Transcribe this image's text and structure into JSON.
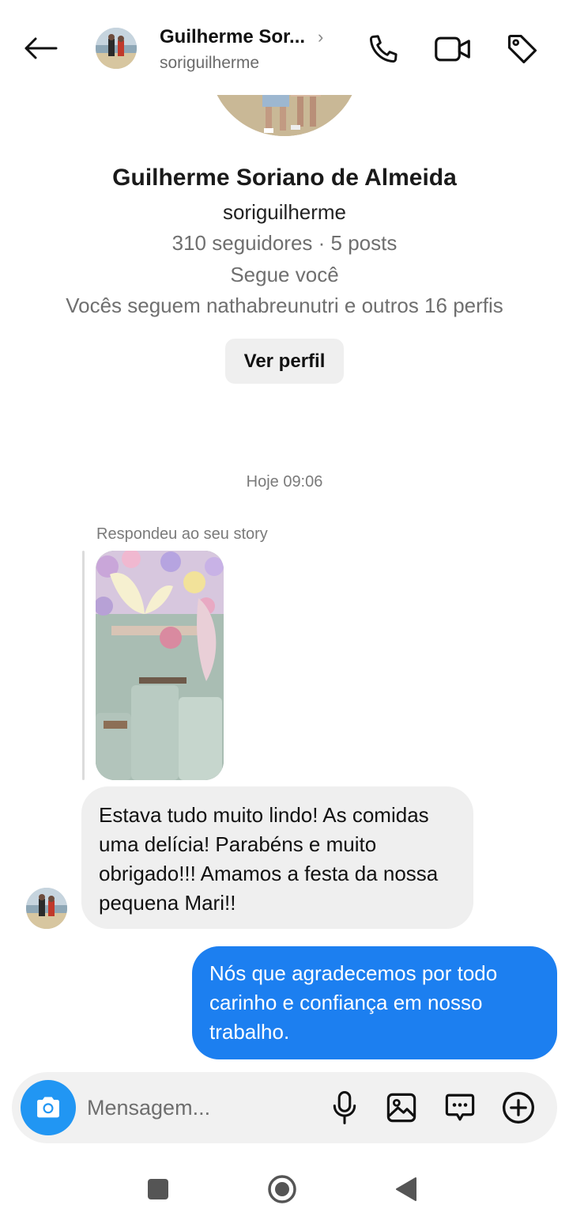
{
  "header": {
    "name": "Guilherme Sor...",
    "username": "soriguilherme"
  },
  "profile": {
    "full_name": "Guilherme Soriano de Almeida",
    "username": "soriguilherme",
    "stats": "310 seguidores · 5 posts",
    "follows_you": "Segue você",
    "mutual": "Vocês seguem nathabreunutri e outros 16 perfis",
    "view_profile_label": "Ver perfil"
  },
  "conversation": {
    "timestamp": "Hoje 09:06",
    "reply_label": "Respondeu ao seu story",
    "messages": [
      {
        "from": "them",
        "text": "Estava tudo muito lindo! As comidas uma delícia! Parabéns e muito obrigado!!! Amamos a festa da nossa pequena Mari!!"
      },
      {
        "from": "me",
        "text": "Nós que agradecemos por todo carinho e confiança em nosso trabalho."
      }
    ]
  },
  "composer": {
    "placeholder": "Mensagem..."
  },
  "icons": {
    "back": "arrow-left-icon",
    "call": "phone-icon",
    "video": "video-camera-icon",
    "tag": "tag-icon",
    "camera": "camera-icon",
    "mic": "microphone-icon",
    "gallery": "image-icon",
    "sticker": "chat-bubble-icon",
    "more": "plus-circle-icon"
  },
  "colors": {
    "accent": "#1c7ff0",
    "camera_button": "#2196f3",
    "incoming_bubble": "#efefef",
    "muted_text": "#6f6f6f"
  }
}
